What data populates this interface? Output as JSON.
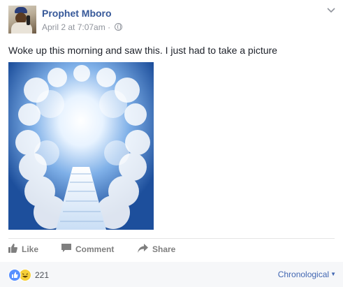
{
  "post": {
    "author": "Prophet Mboro",
    "timestamp": "April 2 at 7:07am",
    "separator": "·",
    "privacy_icon": "globe-icon",
    "options_icon": "chevron-down-icon",
    "text": "Woke up this morning and saw this. I just had to take a picture",
    "image_description_icon": "heaven-stairway-photo"
  },
  "actions": {
    "like": "Like",
    "comment": "Comment",
    "share": "Share"
  },
  "footer": {
    "reaction_count": "221",
    "reaction_icons": [
      "like-icon",
      "haha-icon"
    ],
    "sort_label": "Chronological",
    "sort_caret": "▼"
  },
  "colors": {
    "link_blue": "#365899",
    "muted_gray": "#90949c",
    "sort_blue": "#4267b2",
    "footer_bg": "#f6f7f9"
  }
}
